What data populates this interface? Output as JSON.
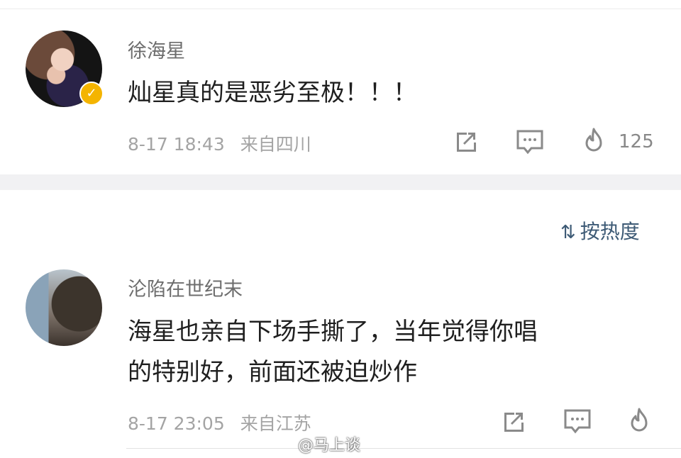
{
  "comments": [
    {
      "username": "徐海星",
      "text": "灿星真的是恶劣至极！！！",
      "time": "8-17 18:43",
      "location": "来自四川",
      "likes": "125",
      "verified": true
    },
    {
      "username": "沦陷在世纪末",
      "text_line1": "海星也亲自下场手撕了，当年觉得你唱",
      "text_line2": "的特别好，前面还被迫炒作",
      "time": "8-17 23:05",
      "location": "来自江苏"
    }
  ],
  "sort": {
    "label": "按热度",
    "icon": "sort-icon"
  },
  "watermark": "@马上谈",
  "colors": {
    "accent": "#3d5a75",
    "badge": "#f4b400",
    "meta": "#a4a4a4"
  }
}
